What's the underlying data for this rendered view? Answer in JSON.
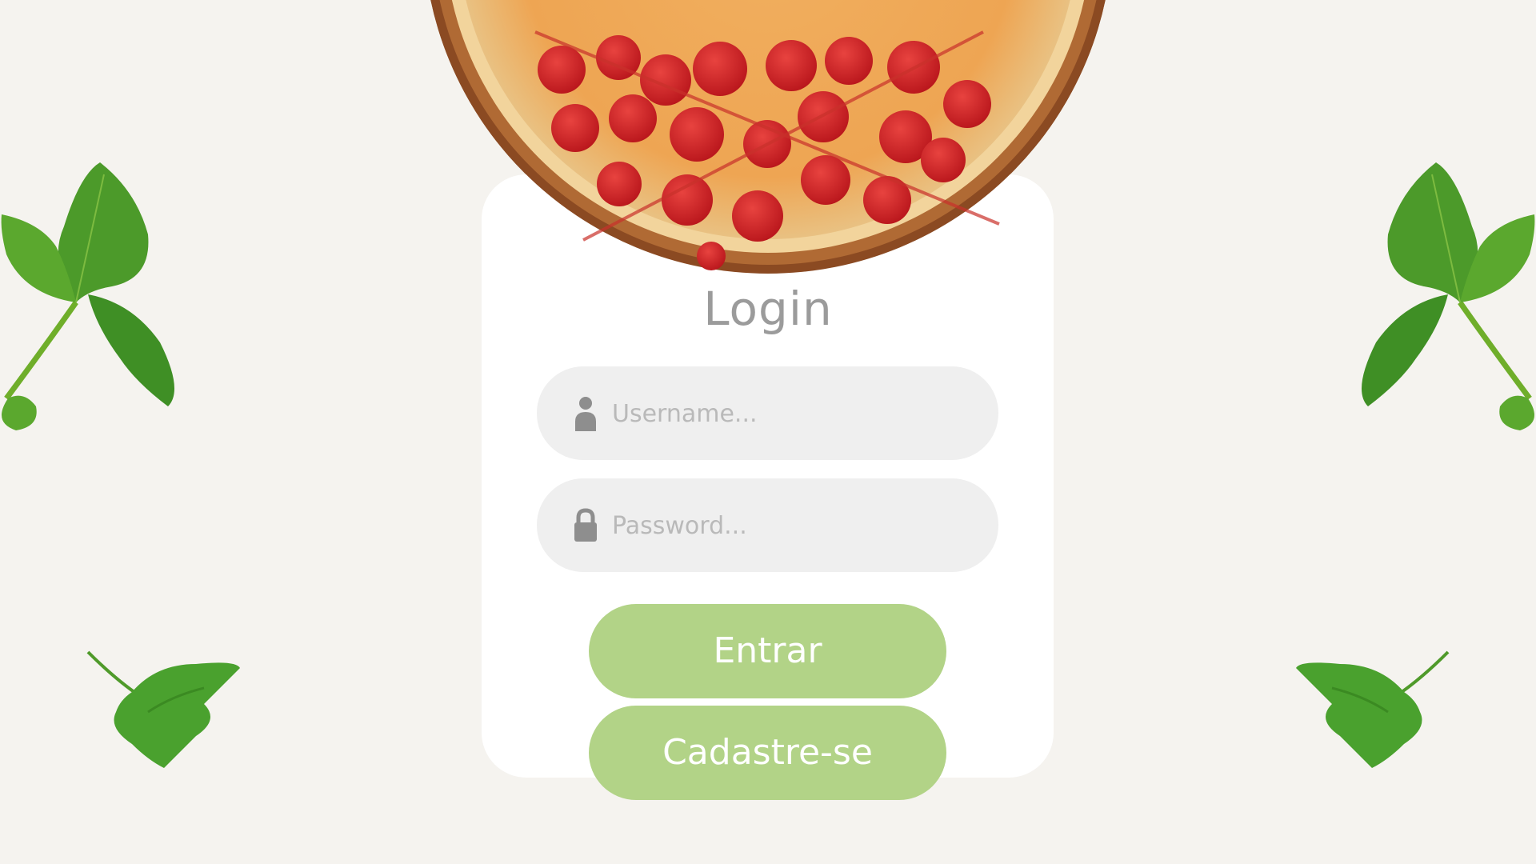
{
  "login": {
    "title": "Login",
    "username": {
      "placeholder": "Username...",
      "icon": "user-icon"
    },
    "password": {
      "placeholder": "Password...",
      "icon": "lock-icon"
    },
    "submit_label": "Entrar",
    "signup_label": "Cadastre-se"
  },
  "colors": {
    "background": "#f5f3ef",
    "card": "#ffffff",
    "button": "#b2d387",
    "field": "#efefef",
    "title": "#9b9b9b"
  }
}
